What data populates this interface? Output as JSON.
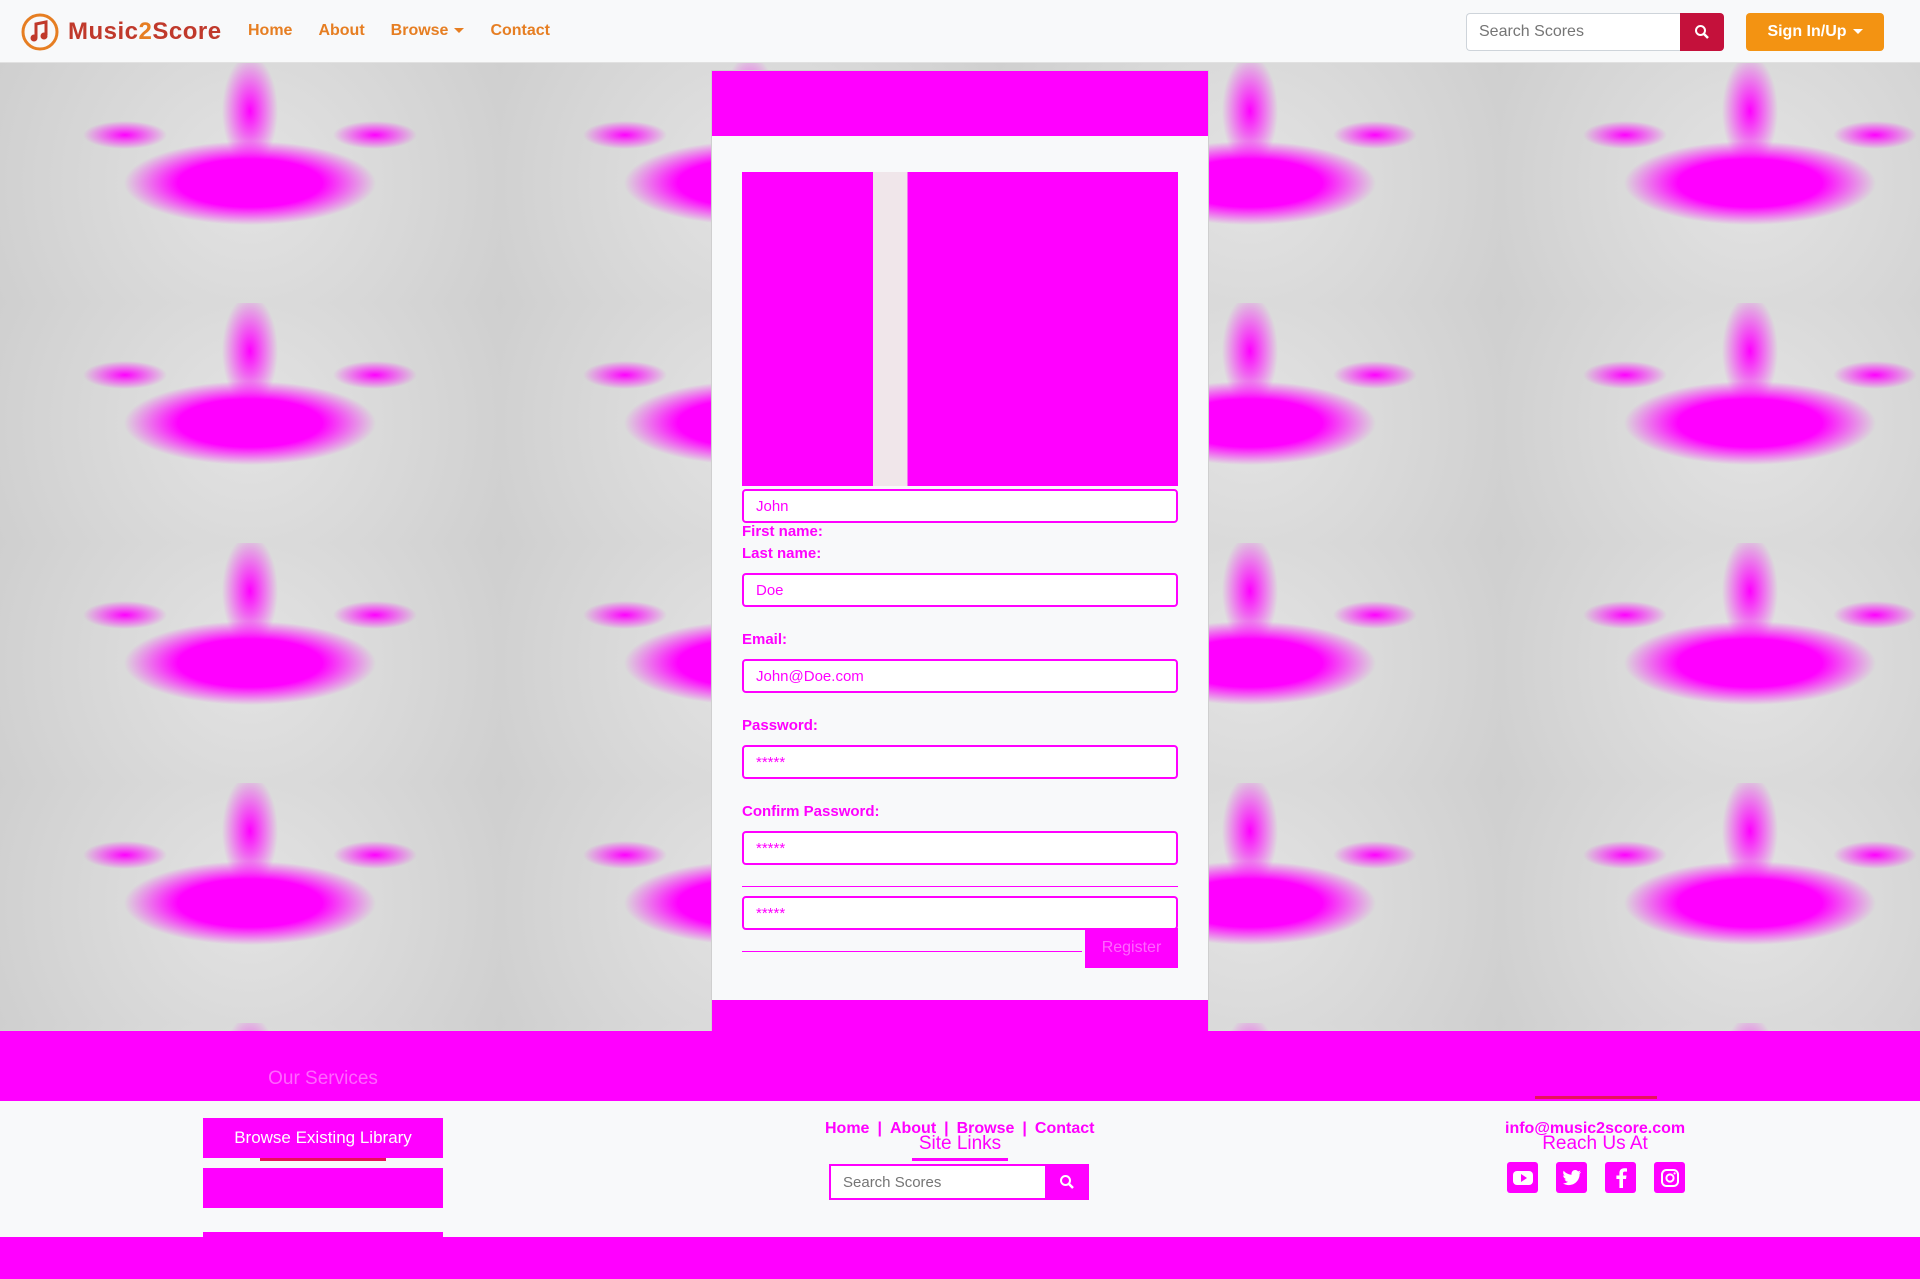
{
  "navbar": {
    "brand": {
      "prefix": "Music",
      "two": "2",
      "suffix": "Score"
    },
    "links": [
      {
        "label": "Home"
      },
      {
        "label": "About"
      },
      {
        "label": "Browse"
      },
      {
        "label": "Contact"
      }
    ],
    "search": {
      "placeholder": "Search Scores"
    },
    "signin_label": "Sign In/Up"
  },
  "register": {
    "fields": [
      {
        "label": "First name:",
        "value": "John"
      },
      {
        "label": "Last name:",
        "value": "Doe"
      },
      {
        "label": "Email:",
        "value": "John@Doe.com"
      },
      {
        "label": "Password:",
        "value": "*****"
      },
      {
        "label": "Confirm Password:",
        "value": "*****"
      }
    ],
    "submit_label": "Register"
  },
  "footer": {
    "services_title": "Our Services",
    "library_buttons": [
      "Browse Existing Library",
      "",
      ""
    ],
    "site_links_title": "Site Links",
    "site_links": [
      "Home",
      "About",
      "Browse",
      "Contact"
    ],
    "search": {
      "placeholder": "Search Scores"
    },
    "reach_title": "Reach Us At",
    "email": "info@music2score.com",
    "socials": [
      "youtube-icon",
      "twitter-icon",
      "facebook-icon",
      "instagram-icon"
    ]
  },
  "colors": {
    "brand_red": "#c0392b",
    "brand_orange": "#e67e22",
    "signin": "#f39312",
    "search_btn": "#c4113b",
    "accent": "#ff00ff"
  }
}
